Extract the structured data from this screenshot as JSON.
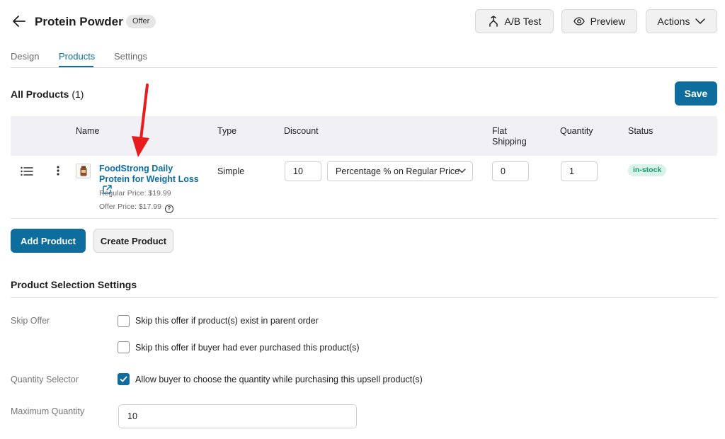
{
  "header": {
    "title": "Protein Powder",
    "badge": "Offer",
    "ab_test_label": "A/B Test",
    "preview_label": "Preview",
    "actions_label": "Actions"
  },
  "tabs": [
    {
      "label": "Design"
    },
    {
      "label": "Products",
      "active": true
    },
    {
      "label": "Settings"
    }
  ],
  "products_section": {
    "title": "All Products",
    "count": "(1)",
    "save_label": "Save"
  },
  "table": {
    "columns": [
      "Name",
      "Type",
      "Discount",
      "Flat Shipping",
      "Quantity",
      "Status"
    ],
    "rows": [
      {
        "name": "FoodStrong Daily Protein for Weight Loss",
        "regular_price": "Regular Price: $19.99",
        "offer_price": "Offer Price: $17.99",
        "type": "Simple",
        "discount_value": "10",
        "discount_type": "Percentage % on Regular Price",
        "flat_shipping": "0",
        "quantity": "1",
        "status": "in-stock"
      }
    ]
  },
  "buttons": {
    "add_product": "Add Product",
    "create_product": "Create Product"
  },
  "selection_settings": {
    "title": "Product Selection Settings",
    "skip_offer_label": "Skip Offer",
    "skip_option_1": "Skip this offer if product(s) exist in parent order",
    "skip_option_2": "Skip this offer if buyer had ever purchased this product(s)",
    "quantity_selector_label": "Quantity Selector",
    "quantity_selector_option": "Allow buyer to choose the quantity while purchasing this upsell product(s)",
    "max_quantity_label": "Maximum Quantity",
    "max_quantity_value": "10"
  },
  "colors": {
    "accent": "#0d6d9f",
    "status_bg": "#d9f3ea",
    "status_text": "#159a6a",
    "annotation_arrow": "#e81c1c"
  },
  "icons": [
    "back-arrow-icon",
    "split-icon",
    "eye-icon",
    "chevron-down-icon",
    "drag-handle-icon",
    "more-vertical-icon",
    "external-link-icon",
    "help-icon",
    "check-icon"
  ]
}
